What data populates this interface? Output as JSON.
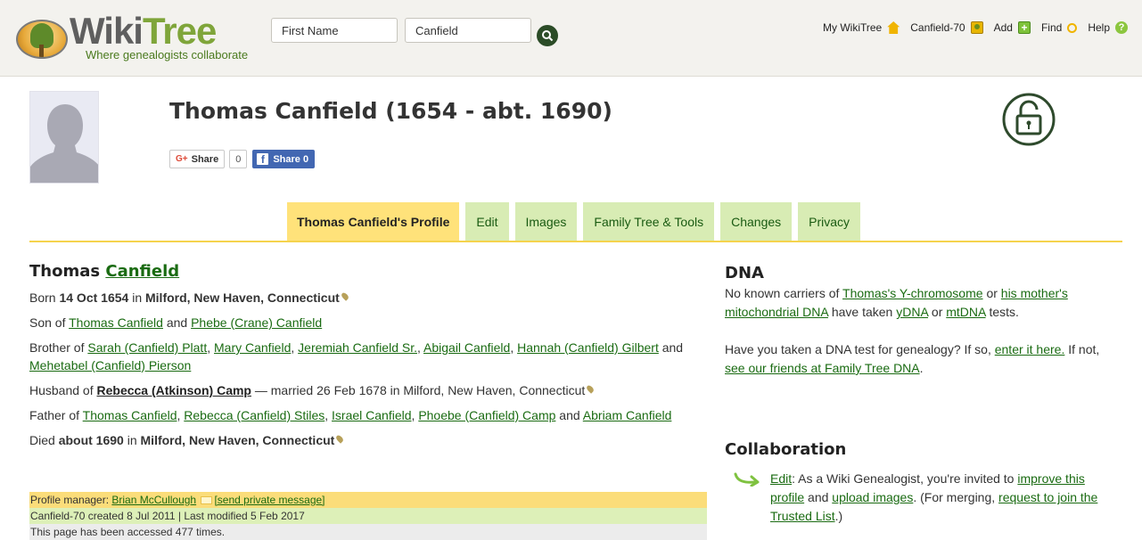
{
  "header": {
    "logo_part1": "Wiki",
    "logo_part2": "Tree",
    "tagline": "Where genealogists collaborate",
    "first_name_placeholder": "First Name",
    "last_name_value": "Canfield",
    "nav": [
      {
        "label": "My WikiTree",
        "icon": "home-icon"
      },
      {
        "label": "Canfield-70",
        "icon": "profile-icon"
      },
      {
        "label": "Add",
        "icon": "add-icon"
      },
      {
        "label": "Find",
        "icon": "find-icon"
      },
      {
        "label": "Help",
        "icon": "help-icon"
      }
    ]
  },
  "profile": {
    "title": "Thomas Canfield (1654 - abt. 1690)",
    "share": {
      "google_label": "Share",
      "google_prefix": "G+",
      "google_count": "0",
      "facebook_label": "Share 0"
    }
  },
  "tabs": [
    {
      "label": "Thomas Canfield's Profile",
      "active": true
    },
    {
      "label": "Edit"
    },
    {
      "label": "Images"
    },
    {
      "label": "Family Tree & Tools"
    },
    {
      "label": "Changes"
    },
    {
      "label": "Privacy"
    }
  ],
  "bio": {
    "first_name": "Thomas",
    "surname": "Canfield",
    "born_prefix": "Born",
    "born_date": "14 Oct 1654",
    "in": "in",
    "born_place": "Milford, New Haven, Connecticut",
    "son_of": "Son of",
    "father": "Thomas Canfield",
    "and": "and",
    "mother": "Phebe (Crane) Canfield",
    "brother_of": "Brother of",
    "siblings": [
      "Sarah (Canfield) Platt",
      "Mary Canfield",
      "Jeremiah Canfield Sr.",
      "Abigail Canfield",
      "Hannah (Canfield) Gilbert",
      "Mehetabel (Canfield) Pierson"
    ],
    "husband_of": "Husband of",
    "spouse": "Rebecca (Atkinson) Camp",
    "married_text": "— married 26 Feb 1678 in Milford, New Haven, Connecticut",
    "father_of": "Father of",
    "children": [
      "Thomas Canfield",
      "Rebecca (Canfield) Stiles",
      "Israel Canfield",
      "Phoebe (Canfield) Camp",
      "Abriam Canfield"
    ],
    "died_prefix": "Died",
    "died_date": "about 1690",
    "died_place": "Milford, New Haven, Connecticut"
  },
  "meta": {
    "manager_label": "Profile manager:",
    "manager_name": "Brian McCullough",
    "send_message": "[send private message]",
    "created": "Canfield-70 created 8 Jul 2011 | Last modified 5 Feb 2017",
    "accessed": "This page has been accessed 477 times."
  },
  "dna": {
    "heading": "DNA",
    "t1": "No known carriers of",
    "link_y": "Thomas's Y-chromosome",
    "t2": "or",
    "link_mito": "his mother's mitochondrial DNA",
    "t3": "have taken",
    "link_ydna": "yDNA",
    "t4": "or",
    "link_mtdna": "mtDNA",
    "t5": "tests.",
    "q1": "Have you taken a DNA test for genealogy? If so,",
    "link_enter": "enter it here.",
    "q2": "If not,",
    "link_friends": "see our friends at Family Tree DNA",
    "q3": "."
  },
  "collaboration": {
    "heading": "Collaboration",
    "link_edit": "Edit",
    "c1": ": As a Wiki Genealogist, you're invited to",
    "link_improve": "improve this profile",
    "c2": "and",
    "link_upload": "upload images",
    "c3": ". (For merging,",
    "link_request": "request to join the Trusted List",
    "c4": ".)"
  },
  "colors": {
    "accent_green": "#1a6b12",
    "tab_green": "#d8ecb4",
    "tab_active": "#ffe27a",
    "divider": "#f5d34d"
  }
}
